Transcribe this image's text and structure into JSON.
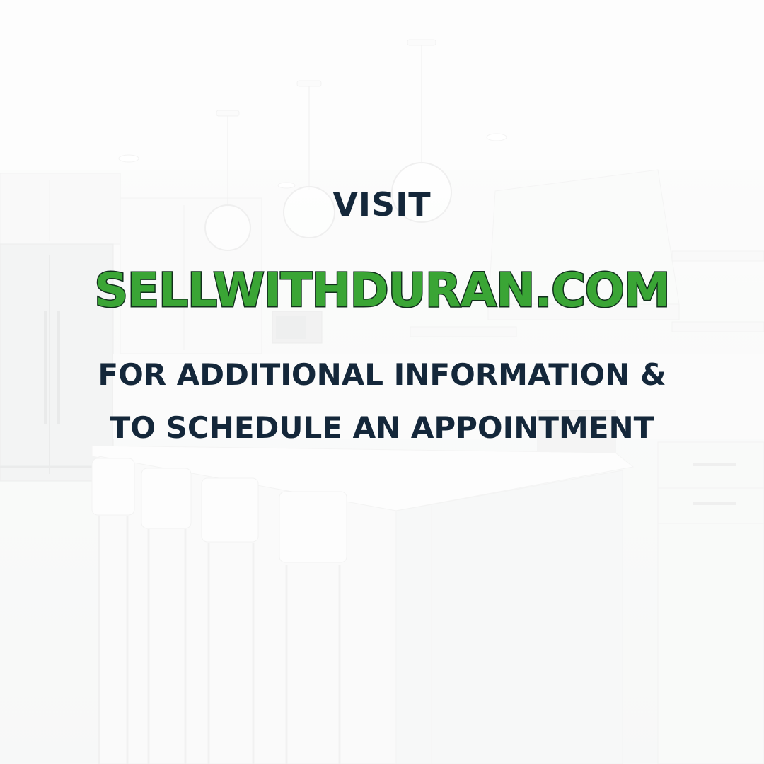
{
  "promo": {
    "visit_label": "VISIT",
    "website": "SELLWITHDURAN.COM",
    "line1": "FOR ADDITIONAL INFORMATION &",
    "line2": "TO SCHEDULE AN APPOINTMENT"
  },
  "colors": {
    "headline_navy": "#14273a",
    "website_green": "#3aa535",
    "website_outline": "#11301c"
  }
}
